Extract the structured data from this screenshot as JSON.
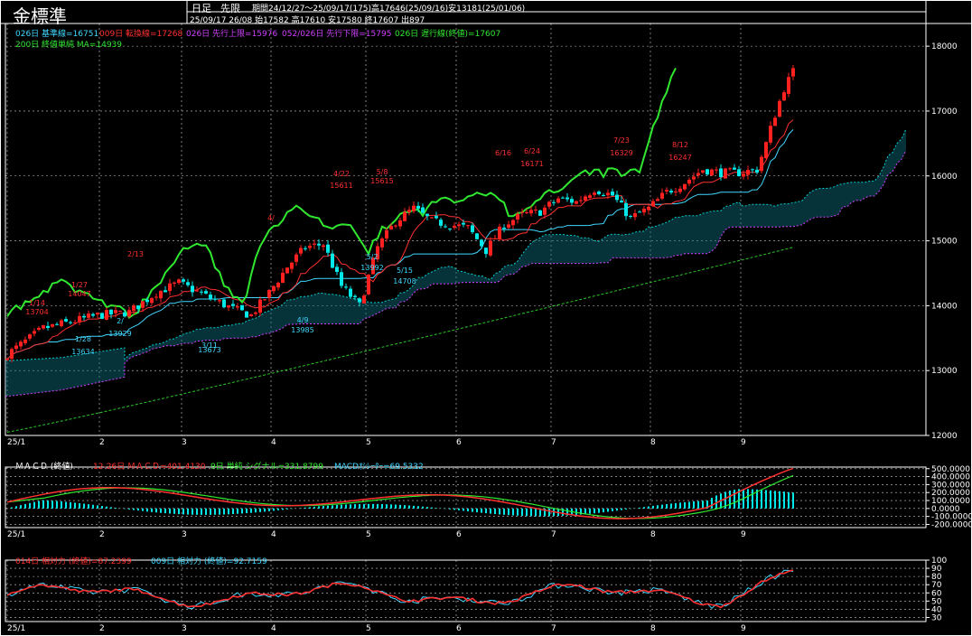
{
  "header": {
    "title": "金標準",
    "mode1": "日足",
    "mode2": "先限",
    "info_line1": "期間24/12/27～25/09/17(175)高17646(25/09/16)安13181(25/01/06)",
    "info_line2": "25/09/17 26/08 始17582 高17610 安17580 終17607 出897"
  },
  "legend": {
    "kijun": "026日 基準線=16751",
    "tenkan": "009日 転換線=17268",
    "senkou_a": "026日 先行上限=15976",
    "senkou_b": "052/026日 先行下限=15795",
    "chikou": "026日 遅行線(終値)=17607",
    "ma200": "200日 終値単純 MA=14939"
  },
  "macd_legend": {
    "title": "ＭＡＣＤ (終値)",
    "macd": "12-26日 ＭＡＣＤ=401.4130",
    "signal": "9日 単純 シグナル=331.8799",
    "osc": "MACDｵｼﾚｰﾀｰ=69.5332"
  },
  "rsi_legend": {
    "rsi14": "014日 相対力 (終値)=87.2399",
    "rsi9": "009日 相対力 (終値)=92.7159"
  },
  "x_ticks": [
    "25/1",
    "2",
    "3",
    "4",
    "5",
    "6",
    "7",
    "8",
    "9"
  ],
  "colors": {
    "up": "#ff2020",
    "down": "#00e8e8",
    "kijun": "#40d8ff",
    "tenkan": "#ff3030",
    "chikou": "#30e830",
    "ma": "#28c828",
    "senkou_a": "#00d0d0",
    "senkou_b": "#d040ff",
    "grid": "#ffffff"
  },
  "chart_data": [
    {
      "type": "candlestick",
      "title": "金標準",
      "y_ticks": [
        12000,
        13000,
        14000,
        15000,
        16000,
        17000,
        18000
      ],
      "ylim": [
        12000,
        18350
      ],
      "annotations": [
        {
          "date": "1/14",
          "value": 13704
        },
        {
          "date": "1/27",
          "value": 14047
        },
        {
          "date": "1/28",
          "value": 13634
        },
        {
          "date": "2/",
          "value": 13929
        },
        {
          "date": "2/13",
          "value": ""
        },
        {
          "date": "3/11",
          "value": 13673
        },
        {
          "date": "4/",
          "value": ""
        },
        {
          "date": "4/9",
          "value": 13985
        },
        {
          "date": "4/22",
          "value": 15611
        },
        {
          "date": "5/2",
          "value": 13992
        },
        {
          "date": "5/8",
          "value": 15615
        },
        {
          "date": "5/15",
          "value": 14708
        },
        {
          "date": "6/16",
          "value": ""
        },
        {
          "date": "6/24",
          "value": 16171
        },
        {
          "date": "7/23",
          "value": 16329
        },
        {
          "date": "8/12",
          "value": 16247
        }
      ],
      "series": [
        {
          "name": "026日 基準線",
          "last": 16751
        },
        {
          "name": "009日 転換線",
          "last": 17268
        },
        {
          "name": "026日 先行上限",
          "last": 15976
        },
        {
          "name": "052/026日 先行下限",
          "last": 15795
        },
        {
          "name": "026日 遅行線(終値)",
          "last": 17607
        },
        {
          "name": "200日 終値単純 MA",
          "last": 14939
        }
      ],
      "last_ohlc": {
        "open": 17582,
        "high": 17610,
        "low": 17580,
        "close": 17607
      }
    },
    {
      "type": "line",
      "title": "ＭＡＣＤ (終値)",
      "y_ticks": [
        -200,
        -100,
        0,
        100,
        200,
        300,
        400,
        500
      ],
      "ylim": [
        -240,
        520
      ],
      "series": [
        {
          "name": "12-26日 ＭＡＣＤ",
          "last": 401.413
        },
        {
          "name": "9日 単純 シグナル",
          "last": 331.8799
        },
        {
          "name": "MACDｵｼﾚｰﾀｰ",
          "last": 69.5332
        }
      ]
    },
    {
      "type": "line",
      "title": "相対力",
      "y_ticks": [
        30,
        40,
        50,
        60,
        70,
        80,
        90,
        100
      ],
      "ylim": [
        25,
        100
      ],
      "series": [
        {
          "name": "014日 相対力 (終値)",
          "last": 87.2399
        },
        {
          "name": "009日 相対力 (終値)",
          "last": 92.7159
        }
      ]
    }
  ]
}
